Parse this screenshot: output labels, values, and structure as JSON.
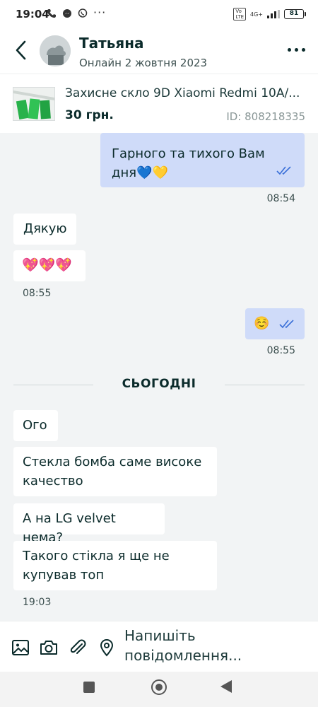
{
  "status_bar": {
    "time": "19:04",
    "network": "4G+",
    "battery": "81"
  },
  "header": {
    "contact_name": "Татьяна",
    "contact_status": "Онлайн 2 жовтня 2023"
  },
  "product": {
    "title": "Захисне скло 9D Xiaomi Redmi 10A/...",
    "price": "30 грн.",
    "id": "ID: 808218335"
  },
  "messages": [
    {
      "direction": "out",
      "text": "Гарного та тихого Вам дня💙💛",
      "time": "08:54",
      "read": true
    },
    {
      "direction": "in",
      "text": "Дякую"
    },
    {
      "direction": "in",
      "text": "💖💖💖",
      "time": "08:55"
    },
    {
      "direction": "out",
      "text": "☺️",
      "time": "08:55",
      "read": true
    },
    {
      "direction": "in",
      "text": "Ого"
    },
    {
      "direction": "in",
      "text": "Стекла бомба саме високе качество"
    },
    {
      "direction": "in",
      "text": "А на LG velvet нема?"
    },
    {
      "direction": "in",
      "text": "Такого стікла я ще не купував топ",
      "time": "19:03"
    }
  ],
  "divider": {
    "label": "СЬОГОДНІ"
  },
  "input": {
    "placeholder": "Напишіть повідомлення..."
  },
  "icons": {
    "back": "chevron-left-icon",
    "more": "more-dots-icon",
    "gallery": "image-icon",
    "camera": "camera-icon",
    "attach": "paperclip-icon",
    "location": "location-pin-icon",
    "read": "double-check-icon"
  },
  "colors": {
    "outgoing_bubble": "#cfdbf9",
    "incoming_bubble": "#ffffff",
    "chat_background": "#f2f4f5",
    "read_ticks": "#3a6fd8",
    "primary_text": "#0b2b2b"
  }
}
